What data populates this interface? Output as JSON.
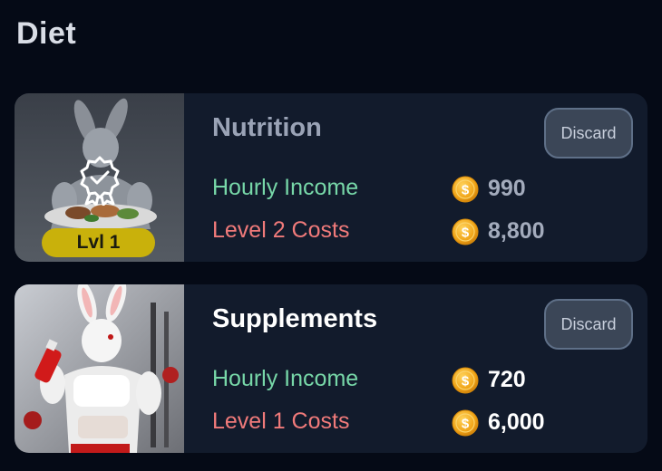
{
  "page": {
    "title": "Diet"
  },
  "cards": [
    {
      "name": "Nutrition",
      "discard_label": "Discard",
      "level_badge": "Lvl 1",
      "income_label": "Hourly Income",
      "income_value": "990",
      "cost_label": "Level 2 Costs",
      "cost_value": "8,800",
      "icons": {
        "coin": "coin-icon",
        "award": "award-badge-icon"
      }
    },
    {
      "name": "Supplements",
      "discard_label": "Discard",
      "income_label": "Hourly Income",
      "income_value": "720",
      "cost_label": "Level 1 Costs",
      "cost_value": "6,000",
      "icons": {
        "coin": "coin-icon"
      }
    }
  ],
  "colors": {
    "background": "#050a16",
    "card": "#121b2c",
    "income": "#77d7a8",
    "cost": "#f07a7a",
    "badge": "#c9b10b",
    "coin": "#f0a417"
  }
}
